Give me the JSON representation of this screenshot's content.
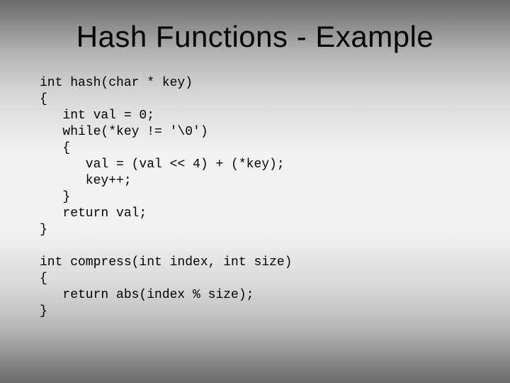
{
  "title": "Hash Functions - Example",
  "code": "int hash(char * key)\n{\n   int val = 0;\n   while(*key != '\\0')\n   {\n      val = (val << 4) + (*key);\n      key++;\n   }\n   return val;\n}\n\nint compress(int index, int size)\n{\n   return abs(index % size);\n}"
}
